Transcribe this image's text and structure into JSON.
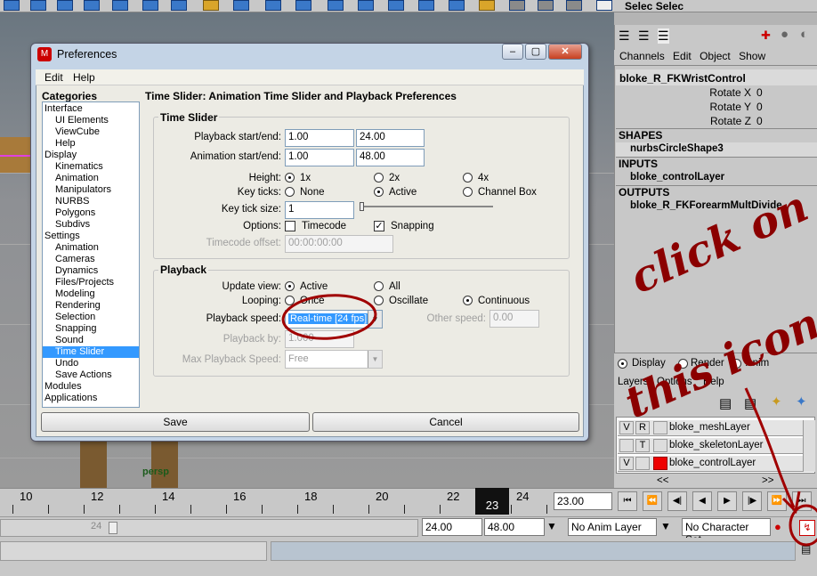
{
  "toolbar": {
    "select_label": "Selec Selec"
  },
  "viewport": {
    "camera_label": "persp"
  },
  "channel_box": {
    "menu": [
      "Channels",
      "Edit",
      "Object",
      "Show"
    ],
    "object": "bloke_R_FKWristControl",
    "attrs": [
      {
        "name": "Rotate X",
        "value": "0"
      },
      {
        "name": "Rotate Y",
        "value": "0"
      },
      {
        "name": "Rotate Z",
        "value": "0"
      }
    ],
    "shapes_header": "SHAPES",
    "shape": "nurbsCircleShape3",
    "inputs_header": "INPUTS",
    "input": "bloke_controlLayer",
    "outputs_header": "OUTPUTS",
    "output": "bloke_R_FKForearmMultDivide"
  },
  "layer_editor": {
    "modes": [
      "Display",
      "Render",
      "Anim"
    ],
    "menu": [
      "Layers",
      "Options",
      "Help"
    ],
    "layers": [
      {
        "v": "V",
        "t": "R",
        "name": "bloke_meshLayer",
        "color": "#e4e4e4"
      },
      {
        "v": "",
        "t": "T",
        "name": "bloke_skeletonLayer",
        "color": "#e4e4e4"
      },
      {
        "v": "V",
        "t": "",
        "name": "bloke_controlLayer",
        "color": "#ee0000"
      }
    ],
    "nav": [
      "<<",
      ">>"
    ]
  },
  "timeline": {
    "ticks": [
      "10",
      "12",
      "14",
      "16",
      "18",
      "20",
      "22",
      "24"
    ],
    "current_frame": "23",
    "current_field": "23.00"
  },
  "range_bar": {
    "left_val": "24",
    "start": "24.00",
    "end": "48.00",
    "anim_layer": "No Anim Layer",
    "char_set": "No Character Set"
  },
  "dialog": {
    "title": "Preferences",
    "menu": [
      "Edit",
      "Help"
    ],
    "categories_label": "Categories",
    "heading": "Time Slider: Animation Time Slider and Playback Preferences",
    "categories": [
      {
        "label": "Interface",
        "level": "top"
      },
      {
        "label": "UI Elements",
        "level": "sub"
      },
      {
        "label": "ViewCube",
        "level": "sub"
      },
      {
        "label": "Help",
        "level": "sub"
      },
      {
        "label": "Display",
        "level": "top"
      },
      {
        "label": "Kinematics",
        "level": "sub"
      },
      {
        "label": "Animation",
        "level": "sub"
      },
      {
        "label": "Manipulators",
        "level": "sub"
      },
      {
        "label": "NURBS",
        "level": "sub"
      },
      {
        "label": "Polygons",
        "level": "sub"
      },
      {
        "label": "Subdivs",
        "level": "sub"
      },
      {
        "label": "Settings",
        "level": "top"
      },
      {
        "label": "Animation",
        "level": "sub"
      },
      {
        "label": "Cameras",
        "level": "sub"
      },
      {
        "label": "Dynamics",
        "level": "sub"
      },
      {
        "label": "Files/Projects",
        "level": "sub"
      },
      {
        "label": "Modeling",
        "level": "sub"
      },
      {
        "label": "Rendering",
        "level": "sub"
      },
      {
        "label": "Selection",
        "level": "sub"
      },
      {
        "label": "Snapping",
        "level": "sub"
      },
      {
        "label": "Sound",
        "level": "sub"
      },
      {
        "label": "Time Slider",
        "level": "sub",
        "selected": true
      },
      {
        "label": "Undo",
        "level": "sub"
      },
      {
        "label": "Save Actions",
        "level": "sub"
      },
      {
        "label": "Modules",
        "level": "top"
      },
      {
        "label": "Applications",
        "level": "top"
      }
    ],
    "time_slider": {
      "group_label": "Time Slider",
      "playback_label": "Playback start/end:",
      "playback_start": "1.00",
      "playback_end": "24.00",
      "animation_label": "Animation start/end:",
      "animation_start": "1.00",
      "animation_end": "48.00",
      "height_label": "Height:",
      "height_options": [
        "1x",
        "2x",
        "4x"
      ],
      "keyticks_label": "Key ticks:",
      "keyticks_options": [
        "None",
        "Active",
        "Channel Box"
      ],
      "keytick_size_label": "Key tick size:",
      "keytick_size": "1",
      "options_label": "Options:",
      "timecode_label": "Timecode",
      "snapping_label": "Snapping",
      "timecode_offset_label": "Timecode offset:",
      "timecode_offset": "00:00:00:00"
    },
    "playback": {
      "group_label": "Playback",
      "update_label": "Update view:",
      "update_options": [
        "Active",
        "All"
      ],
      "looping_label": "Looping:",
      "looping_options": [
        "Once",
        "Oscillate",
        "Continuous"
      ],
      "speed_label": "Playback speed:",
      "speed_value": "Real-time [24 fps]",
      "other_speed_label": "Other speed:",
      "other_speed": "0.00",
      "playback_by_label": "Playback by:",
      "playback_by": "1.000",
      "max_speed_label": "Max Playback Speed:",
      "max_speed": "Free"
    },
    "buttons": {
      "save": "Save",
      "cancel": "Cancel"
    }
  },
  "annotation": {
    "line1": "click on",
    "line2": "this icon"
  }
}
